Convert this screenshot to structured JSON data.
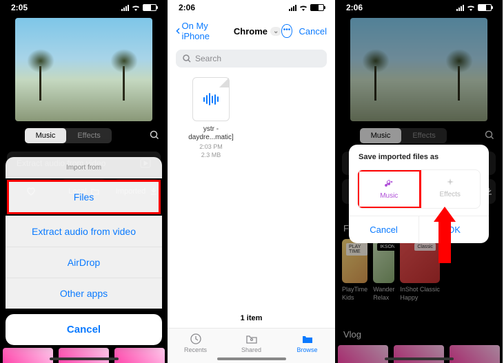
{
  "status": {
    "t1": "2:05",
    "t2": "2:06",
    "t3": "2:06"
  },
  "editor": {
    "tabs": {
      "music": "Music",
      "effects": "Effects"
    },
    "extract": "Extract audio from video",
    "local": "Local",
    "imported": "Imported"
  },
  "sheet1": {
    "title": "Import from",
    "files": "Files",
    "extract": "Extract audio from video",
    "airdrop": "AirDrop",
    "other": "Other apps",
    "cancel": "Cancel"
  },
  "vlog": "Vlog",
  "files": {
    "back": "On My iPhone",
    "folder": "Chrome",
    "cancel": "Cancel",
    "search": "Search",
    "fname1": "ystr -",
    "fname2": "daydre...matic]",
    "time": "2:03 PM",
    "size": "2.3 MB",
    "count": "1 item",
    "recents": "Recents",
    "shared": "Shared",
    "browse": "Browse"
  },
  "modal": {
    "title": "Save imported files as",
    "music": "Music",
    "effects": "Effects",
    "cancel": "Cancel",
    "ok": "OK"
  },
  "foryou": {
    "title": "For you",
    "b1": "PLAY TIME",
    "b2": "IKSON",
    "b3": "Classic",
    "l1a": "PlayTime",
    "l1b": "Kids",
    "l2a": "Wander",
    "l2b": "Relax",
    "l3a": "InShot Classic",
    "l3b": "Happy"
  }
}
